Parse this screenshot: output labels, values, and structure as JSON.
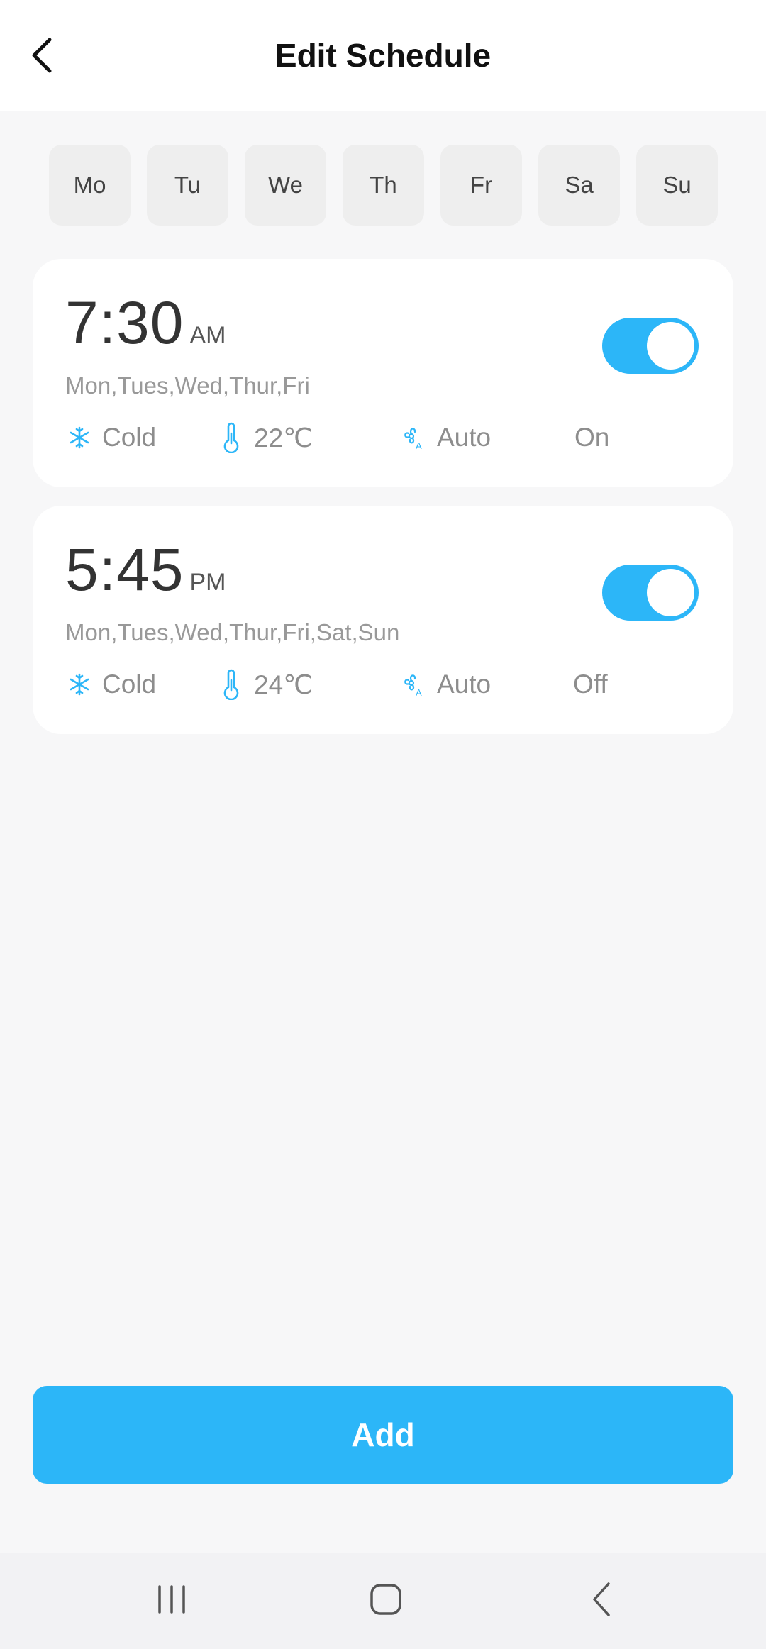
{
  "header": {
    "title": "Edit Schedule",
    "back_icon": "chevron-left-icon"
  },
  "day_selector": [
    "Mo",
    "Tu",
    "We",
    "Th",
    "Fr",
    "Sa",
    "Su"
  ],
  "schedules": [
    {
      "time": "7:30",
      "period": "AM",
      "days": "Mon,Tues,Wed,Thur,Fri",
      "mode": "Cold",
      "temperature": "22℃",
      "fan": "Auto",
      "power": "On",
      "enabled": true
    },
    {
      "time": "5:45",
      "period": "PM",
      "days": "Mon,Tues,Wed,Thur,Fri,Sat,Sun",
      "mode": "Cold",
      "temperature": "24℃",
      "fan": "Auto",
      "power": "Off",
      "enabled": true
    }
  ],
  "add_button": {
    "label": "Add"
  },
  "colors": {
    "accent": "#2cb6f8",
    "background": "#f7f7f8",
    "card": "#ffffff",
    "chip": "#eeeeee"
  },
  "nav_bar": {
    "icons": [
      "recent-apps-icon",
      "home-icon",
      "back-icon"
    ]
  }
}
